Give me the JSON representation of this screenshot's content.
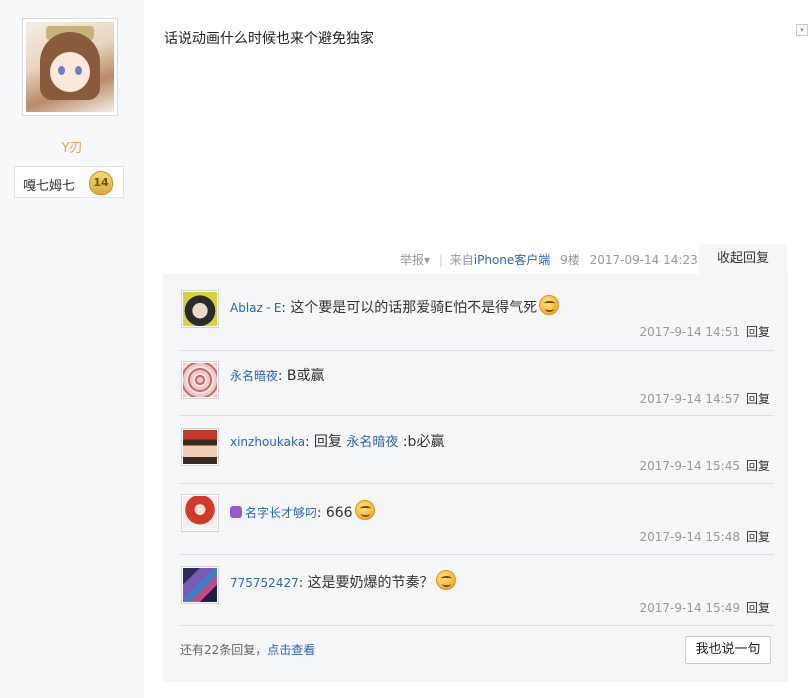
{
  "author": {
    "avatar_icon": "anime-girl-avatar",
    "name": "Y刃",
    "rank_label": "嘎七姆七",
    "rank_level": "14"
  },
  "post": {
    "content": "话说动画什么时候也来个避免独家",
    "menu_icon": "▾"
  },
  "tail": {
    "report": "举报",
    "report_arrow": "▾",
    "separator": "|",
    "source_prefix": "来自",
    "source_device": "iPhone客户端",
    "floor": "9楼",
    "timestamp": "2017-09-14 14:23",
    "collapse_label": "收起回复"
  },
  "replies": [
    {
      "avatar_icon": "dark-hair-character-avatar",
      "name": "Ablaz ╴E",
      "colon": ":",
      "text": " 这个要是可以的话那爱骑E怕不是得气死",
      "has_smiley": true,
      "time": "2017-9-14 14:51",
      "reply_label": "回复"
    },
    {
      "avatar_icon": "mandala-avatar",
      "name": "永名暗夜",
      "colon": ":",
      "text": " B或赢",
      "has_smiley": false,
      "time": "2017-9-14 14:57",
      "reply_label": "回复"
    },
    {
      "avatar_icon": "girl-red-hat-avatar",
      "name": "xinzhoukaka",
      "colon": ":",
      "text_prefix": " 回复 ",
      "mention": "永名暗夜",
      "text": " :b必赢",
      "has_smiley": false,
      "time": "2017-9-14 15:45",
      "reply_label": "回复"
    },
    {
      "avatar_icon": "red-hair-character-avatar",
      "name": "名字长才够叼",
      "vip": true,
      "colon": ":",
      "text": " 666",
      "has_smiley": true,
      "time": "2017-9-14 15:48",
      "reply_label": "回复"
    },
    {
      "avatar_icon": "purple-mecha-avatar",
      "name": "775752427",
      "colon": ":",
      "text": " 这是要奶爆的节奏？",
      "has_smiley": true,
      "time": "2017-9-14 15:49",
      "reply_label": "回复"
    }
  ],
  "footer": {
    "more_prefix": "还有22条回复，",
    "more_link": "点击查看",
    "say_button": "我也说一句"
  },
  "colors": {
    "link_blue": "#2d64b3",
    "username_orange": "#e5a25a",
    "reply_bg": "#f4f6f8",
    "meta_gray": "#999999"
  }
}
